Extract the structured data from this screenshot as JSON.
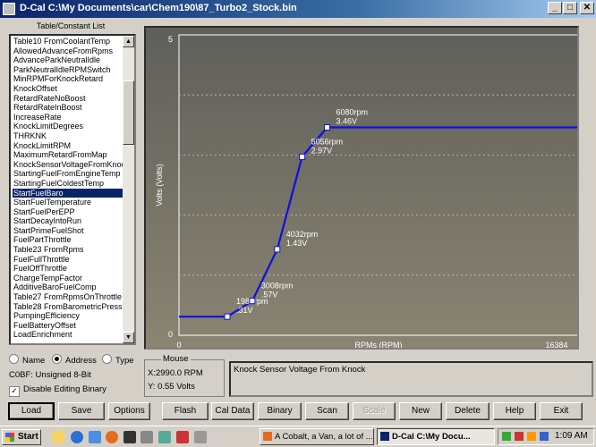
{
  "window": {
    "app": "D-Cal",
    "title": "D-Cal  C:\\My Documents\\car\\Chem190\\87_Turbo2_Stock.bin"
  },
  "list": {
    "header": "Table/Constant List",
    "selected_index": 16,
    "items": [
      "Table10 FromCoolantTemp",
      "AllowedAdvanceFromRpms",
      "AdvanceParkNeutralIdle",
      "ParkNeutralIdleRPMSwitch",
      "MinRPMForKnockRetard",
      "KnockOffset",
      "RetardRateNoBoost",
      "RetardRateInBoost",
      "IncreaseRate",
      "KnockLimitDegrees",
      "THRKNK",
      "KnockLimitRPM",
      "MaximumRetardFromMap",
      "KnockSensorVoltageFromKnoc",
      "StartingFuelFromEngineTemp",
      "StartingFuelColdestTemp",
      "StartFuelBaro",
      "StartFuelTemperature",
      "StartFuelPerEPP",
      "StartDecayIntoRun",
      "StartPrimeFuelShot",
      "FuelPartThrottle",
      "Table23 FromRpms",
      "FuelFullThrottle",
      "FuelOffThrottle",
      "ChargeTempFactor",
      "AdditiveBaroFuelComp",
      "Table27 FromRpmsOnThrottle",
      "Table28 FromBarometricPressu",
      "PumpingEfficiency",
      "FuelBatteryOffset",
      "LoadEnrichment"
    ]
  },
  "view_mode": {
    "options": [
      "Name",
      "Address",
      "Type"
    ],
    "selected": "Address"
  },
  "cobf": "C0BF: Unsigned 8-Bit",
  "disable_editing": {
    "label": "Disable Editing Binary",
    "checked": true
  },
  "chart_data": {
    "type": "line",
    "xlabel": "RPMs (RPM)",
    "ylabel": "Volts (Volts)",
    "xlim": [
      0,
      16384
    ],
    "ylim": [
      0,
      5
    ],
    "x_tick_labels": [
      "0",
      "16384"
    ],
    "y_tick_labels": [
      "0",
      "5"
    ],
    "grid": "horizontal dashed",
    "series": [
      {
        "color": "#1010e0",
        "points": [
          {
            "x": 0,
            "y": 0.31
          },
          {
            "x": 1984,
            "y": 0.31
          },
          {
            "x": 3008,
            "y": 0.57
          },
          {
            "x": 4032,
            "y": 1.43
          },
          {
            "x": 5056,
            "y": 2.97
          },
          {
            "x": 6080,
            "y": 3.46
          },
          {
            "x": 16384,
            "y": 3.46
          }
        ]
      }
    ],
    "annotations": [
      {
        "x": 1984,
        "y": 0.31,
        "line1": "1984rpm",
        "line2": ".31V"
      },
      {
        "x": 3008,
        "y": 0.57,
        "line1": "3008rpm",
        "line2": ".57V"
      },
      {
        "x": 4032,
        "y": 1.43,
        "line1": "4032rpm",
        "line2": "1.43V"
      },
      {
        "x": 5056,
        "y": 2.97,
        "line1": "5056rpm",
        "line2": "2.97V"
      },
      {
        "x": 6080,
        "y": 3.46,
        "line1": "6080rpm",
        "line2": "3.46V"
      }
    ]
  },
  "mouse": {
    "label": "Mouse",
    "x": "X:2990.0 RPM",
    "y": "Y: 0.55 Volts"
  },
  "description": "Knock Sensor Voltage From Knock",
  "buttons": [
    "Load",
    "Save",
    "Options",
    "Flash",
    "Cal Data",
    "Binary",
    "Scan",
    "Scale",
    "New",
    "Delete",
    "Help",
    "Exit"
  ],
  "disabled_buttons": [
    "Scale"
  ],
  "taskbar": {
    "start": "Start",
    "tasks": [
      "A Cobalt, a Van, a lot of ...",
      "D-Cal  C:\\My Docu..."
    ],
    "clock": "1:09 AM"
  }
}
